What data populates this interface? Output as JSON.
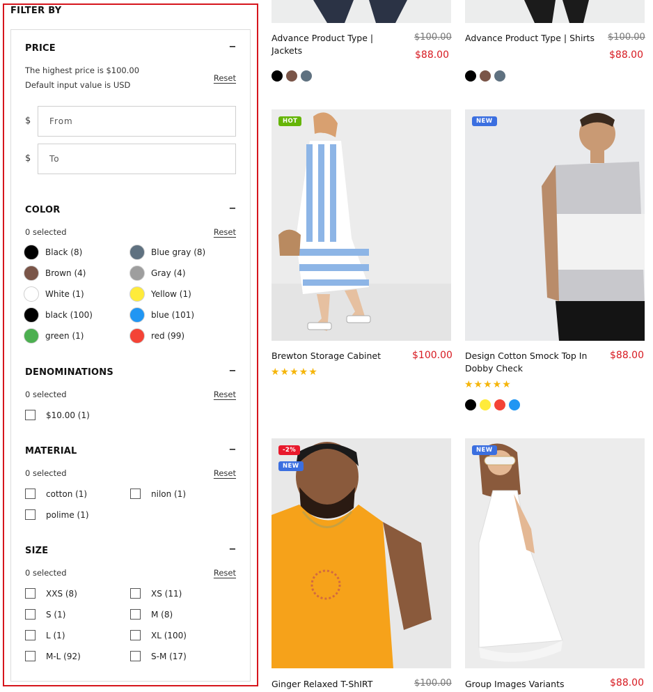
{
  "filter": {
    "heading": "FILTER BY",
    "reset_label": "Reset",
    "price": {
      "title": "PRICE",
      "info_line1": "The highest price is $100.00",
      "info_line2": "Default input value is USD",
      "currency": "$",
      "from_placeholder": "From",
      "to_placeholder": "To"
    },
    "color": {
      "title": "COLOR",
      "selected": "0 selected",
      "items": [
        {
          "label": "Black (8)",
          "color": "#000000"
        },
        {
          "label": "Blue gray (8)",
          "color": "#5f7180"
        },
        {
          "label": "Brown (4)",
          "color": "#7a5548"
        },
        {
          "label": "Gray (4)",
          "color": "#9e9e9e"
        },
        {
          "label": "White (1)",
          "color": "#ffffff"
        },
        {
          "label": "Yellow (1)",
          "color": "#ffeb3b"
        },
        {
          "label": "black (100)",
          "color": "#000000"
        },
        {
          "label": "blue (101)",
          "color": "#2196f3"
        },
        {
          "label": "green (1)",
          "color": "#4caf50"
        },
        {
          "label": "red (99)",
          "color": "#f44336"
        }
      ]
    },
    "denominations": {
      "title": "DENOMINATIONS",
      "selected": "0 selected",
      "items": [
        {
          "label": "$10.00 (1)"
        }
      ]
    },
    "material": {
      "title": "MATERIAL",
      "selected": "0 selected",
      "items": [
        {
          "label": "cotton (1)"
        },
        {
          "label": "nilon (1)"
        },
        {
          "label": "polime (1)"
        }
      ]
    },
    "size": {
      "title": "SIZE",
      "selected": "0 selected",
      "items": [
        {
          "label": "XXS (8)"
        },
        {
          "label": "XS (11)"
        },
        {
          "label": "S (1)"
        },
        {
          "label": "M (8)"
        },
        {
          "label": "L (1)"
        },
        {
          "label": "XL (100)"
        },
        {
          "label": "M-L (92)"
        },
        {
          "label": "S-M (17)"
        }
      ]
    }
  },
  "products": [
    {
      "name": "Advance Product Type | Jackets",
      "old_price": "$100.00",
      "price": "$88.00",
      "colors": [
        "#000000",
        "#7a5548",
        "#5f7180"
      ]
    },
    {
      "name": "Advance Product Type | Shirts",
      "old_price": "$100.00",
      "price": "$88.00",
      "colors": [
        "#000000",
        "#7a5548",
        "#5f7180"
      ]
    },
    {
      "name": "Brewton Storage Cabinet",
      "price": "$100.00",
      "badges": [
        "HOT"
      ],
      "stars": "★★★★★",
      "rating": 5
    },
    {
      "name": "Design Cotton Smock Top In Dobby Check",
      "price": "$88.00",
      "badges": [
        "NEW"
      ],
      "stars": "★★★★★",
      "rating": 5,
      "colors": [
        "#000000",
        "#ffeb3b",
        "#f44336",
        "#2196f3"
      ]
    },
    {
      "name": "Ginger Relaxed T-ShIRT",
      "old_price": "$100.00",
      "badges": [
        "-2%",
        "NEW"
      ]
    },
    {
      "name": "Group Images Variants",
      "price": "$88.00",
      "badges": [
        "NEW"
      ]
    }
  ],
  "colors": {
    "accent_red": "#d71920",
    "badge_hot": "#65b507",
    "badge_new": "#3b6fe0",
    "badge_sale": "#e8192c",
    "star": "#f5b50a",
    "outline": "#d6151c"
  }
}
